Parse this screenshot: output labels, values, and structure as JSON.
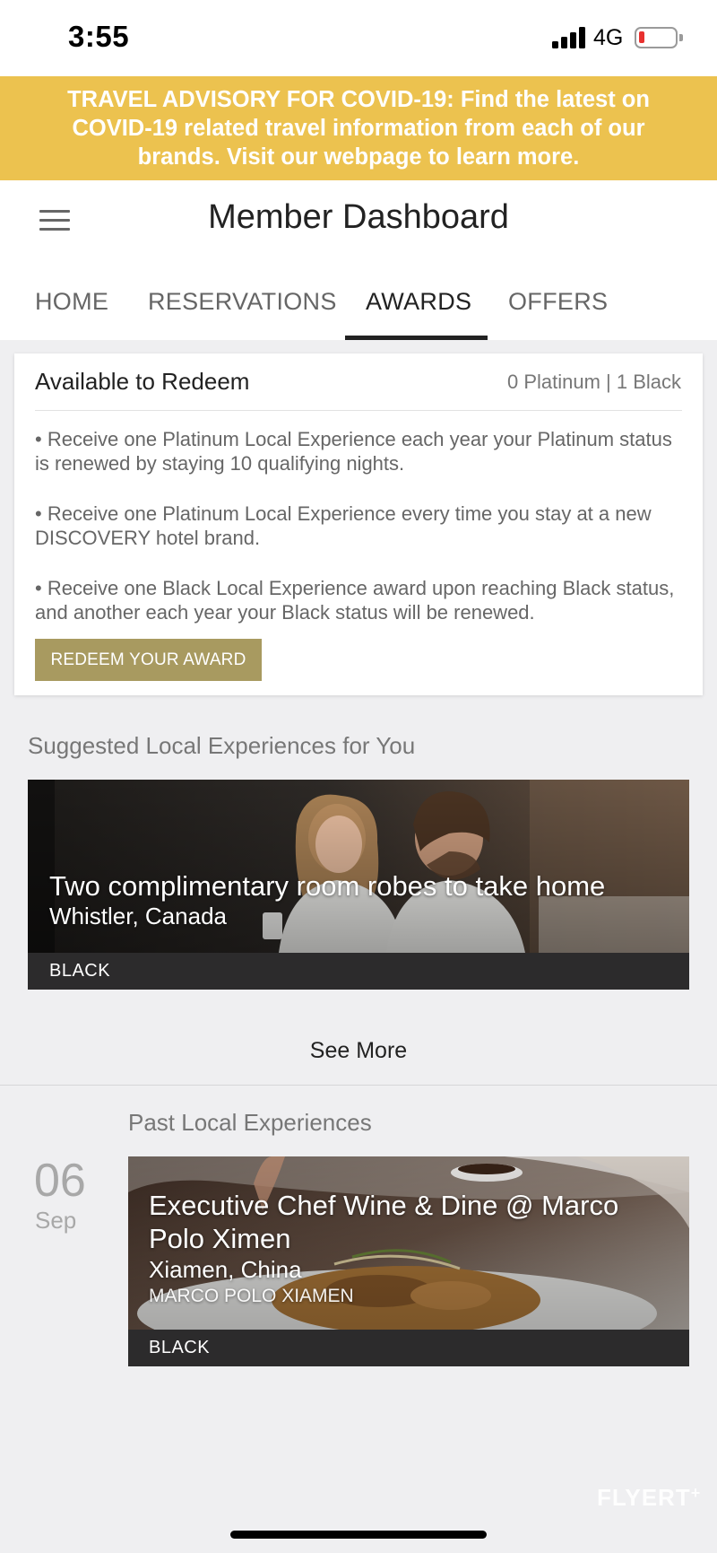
{
  "status_bar": {
    "time": "3:55",
    "network": "4G"
  },
  "advisory": {
    "text": "TRAVEL ADVISORY FOR COVID-19: Find the latest on COVID-19 related travel information from each of our brands. Visit our webpage to learn more."
  },
  "header": {
    "title": "Member Dashboard"
  },
  "tabs": [
    {
      "label": "HOME"
    },
    {
      "label": "RESERVATIONS"
    },
    {
      "label": "AWARDS"
    },
    {
      "label": "OFFERS"
    }
  ],
  "redeem": {
    "title": "Available to Redeem",
    "counts": "0 Platinum | 1 Black",
    "bullets": [
      "• Receive one Platinum Local Experience each year your Platinum status is renewed by staying 10 qualifying nights.",
      "• Receive one Platinum Local Experience every time you stay at a new DISCOVERY hotel brand.",
      "• Receive one Black Local Experience award upon reaching Black status, and another each year your Black status will be renewed."
    ],
    "button_label": "REDEEM YOUR AWARD"
  },
  "suggested": {
    "heading": "Suggested Local Experiences for You",
    "card": {
      "title": "Two complimentary room robes to take home",
      "location": "Whistler, Canada",
      "tier": "BLACK"
    },
    "see_more": "See More"
  },
  "past": {
    "heading": "Past Local Experiences",
    "date_day": "06",
    "date_month": "Sep",
    "card": {
      "title": "Executive Chef Wine & Dine @ Marco Polo Ximen",
      "location": "Xiamen, China",
      "hotel": "MARCO POLO XIAMEN",
      "tier": "BLACK"
    }
  },
  "watermark": {
    "text": "FLYERT"
  },
  "colors": {
    "advisory_bg": "#ecc24f",
    "redeem_button": "#a89a60",
    "page_bg": "#efeff1",
    "tier_bar": "#2c2b2c",
    "battery_low": "#e8312f"
  }
}
